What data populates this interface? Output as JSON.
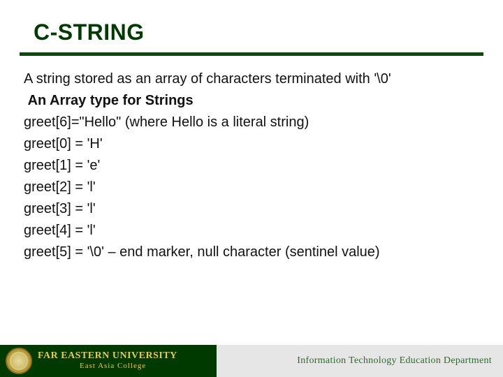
{
  "title": "C-STRING",
  "body": {
    "line1": "A string stored as an array of characters terminated with '\\0'",
    "line2": "An Array type for Strings",
    "line3": "greet[6]=\"Hello\"  (where Hello is  a literal string)",
    "line4": "greet[0] = 'H'",
    "line5": "greet[1] = 'e'",
    "line6": "greet[2] = 'l'",
    "line7": "greet[3] = 'l'",
    "line8": "greet[4] = 'l'",
    "line9": "greet[5] = '\\0' – end marker, null character (sentinel value)"
  },
  "footer": {
    "university_line1": "FAR EASTERN UNIVERSITY",
    "university_line2": "East Asia College",
    "department": "Information Technology Education Department"
  }
}
